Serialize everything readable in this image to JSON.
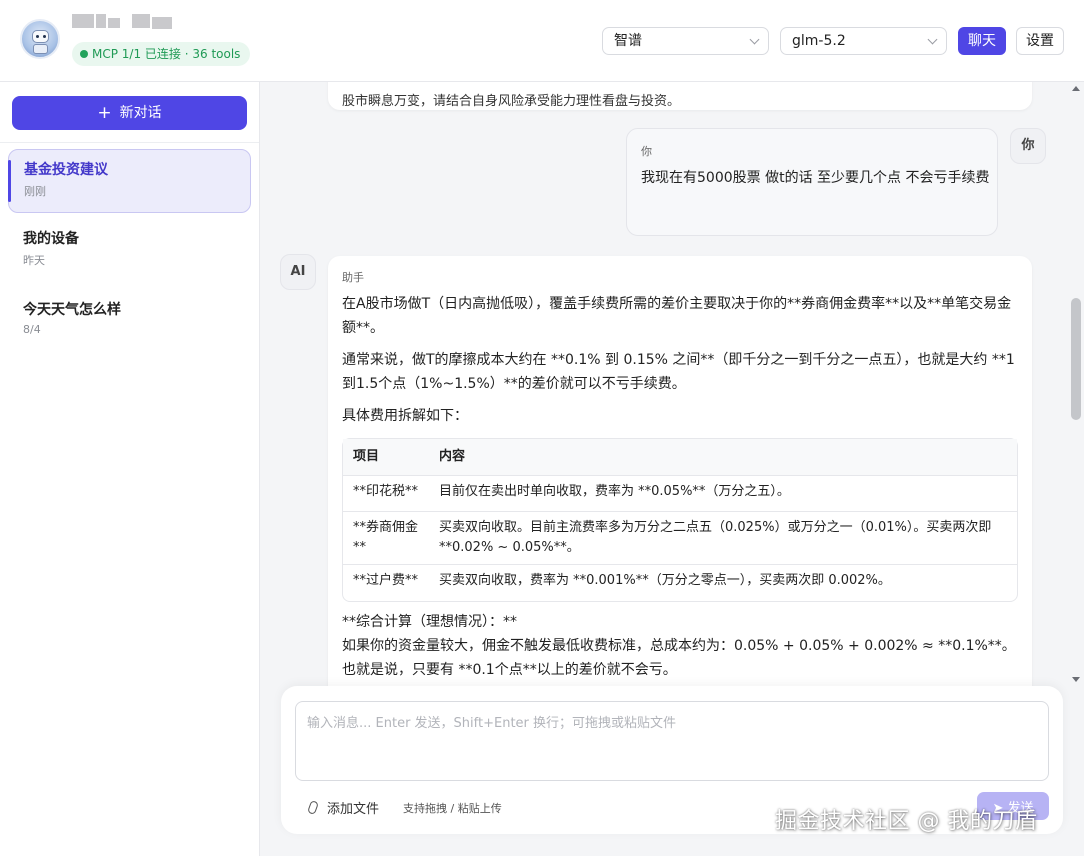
{
  "header": {
    "mcp_status": "MCP 1/1 已连接 · 36 tools",
    "provider": "智谱",
    "model": "glm-5.2",
    "chat_label": "聊天",
    "settings_label": "设置"
  },
  "sidebar": {
    "new_chat_label": "新对话",
    "conversations": [
      {
        "title": "基金投资建议",
        "time": "刚刚"
      },
      {
        "title": "我的设备",
        "time": "昨天"
      },
      {
        "title": "今天天气怎么样",
        "time": "8/4"
      }
    ]
  },
  "messages": {
    "prev_assistant_tail": "股市瞬息万变，请结合自身风险承受能力理性看盘与投资。",
    "user": {
      "role": "你",
      "avatar": "你",
      "text": "我现在有5000股票 做t的话 至少要几个点 不会亏手续费"
    },
    "assistant": {
      "role": "助手",
      "avatar": "AI",
      "p1": "在A股市场做T（日内高抛低吸），覆盖手续费所需的差价主要取决于你的**券商佣金费率**以及**单笔交易金额**。",
      "p2": "通常来说，做T的摩擦成本大约在 **0.1% 到 0.15% 之间**（即千分之一到千分之一点五），也就是大约 **1到1.5个点（1%~1.5%）**的差价就可以不亏手续费。",
      "p3": "具体费用拆解如下：",
      "table": {
        "headers": [
          "项目",
          "内容"
        ],
        "rows": [
          [
            "**印花税**",
            "目前仅在卖出时单向收取，费率为 **0.05%**（万分之五）。"
          ],
          [
            "**券商佣金**",
            "买卖双向收取。目前主流费率多为万分之二点五（0.025%）或万分之一（0.01%）。买卖两次即 **0.02% ~ 0.05%**。"
          ],
          [
            "**过户费**",
            "买卖双向收取，费率为 **0.001%**（万分之零点一），买卖两次即 0.002%。"
          ]
        ]
      },
      "p4_title": "**综合计算（理想情况）：**",
      "p4": "如果你的资金量较大，佣金不触发最低收费标准，总成本约为：0.05% + 0.05% + 0.002% ≈ **0.1%**。也就是说，只要有 **0.1个点**以上的差价就不会亏。"
    }
  },
  "composer": {
    "placeholder": "输入消息... Enter 发送，Shift+Enter 换行；可拖拽或粘贴文件",
    "attach_label": "添加文件",
    "hint": "支持拖拽 / 粘贴上传",
    "send_label": "发送"
  },
  "watermark": "掘金技术社区 @ 我的刀盾",
  "icons": {
    "attach": "paperclip-icon",
    "send": "send-icon",
    "new_chat": "plus-icon"
  }
}
